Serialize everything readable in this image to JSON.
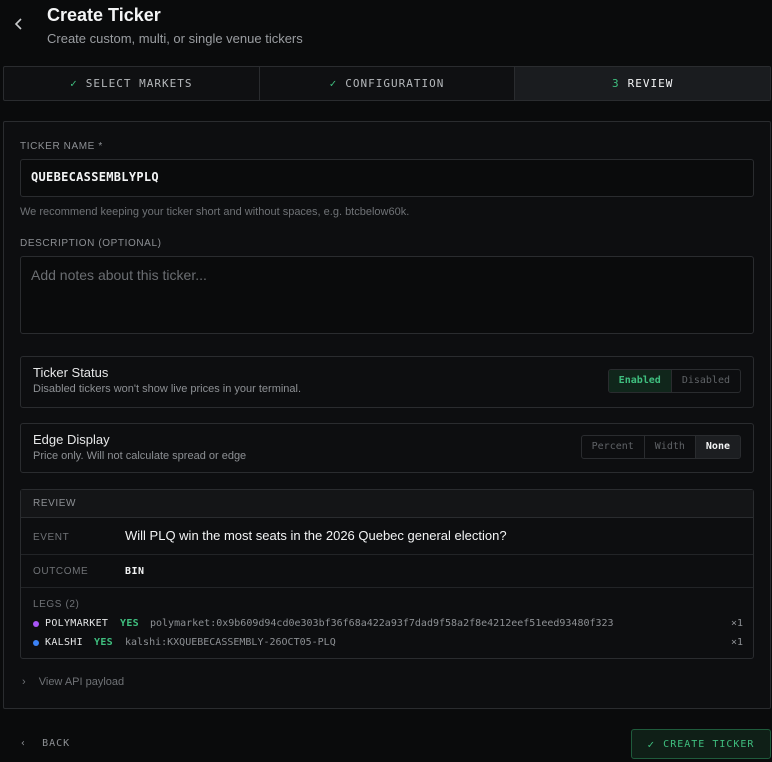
{
  "header": {
    "title": "Create Ticker",
    "subtitle": "Create custom, multi, or single venue tickers"
  },
  "steps": [
    {
      "label": "SELECT MARKETS",
      "state": "done"
    },
    {
      "label": "CONFIGURATION",
      "state": "done"
    },
    {
      "number": "3",
      "label": "REVIEW",
      "state": "active"
    }
  ],
  "form": {
    "ticker_name_label": "TICKER NAME *",
    "ticker_name_value": "QUEBECASSEMBLYPLQ",
    "ticker_name_hint": "We recommend keeping your ticker short and without spaces, e.g. btcbelow60k.",
    "description_label": "DESCRIPTION (OPTIONAL)",
    "description_placeholder": "Add notes about this ticker..."
  },
  "status": {
    "title": "Ticker Status",
    "subtitle": "Disabled tickers won't show live prices in your terminal.",
    "options": [
      "Enabled",
      "Disabled"
    ],
    "selected": "Enabled"
  },
  "edge": {
    "title": "Edge Display",
    "subtitle": "Price only. Will not calculate spread or edge",
    "options": [
      "Percent",
      "Width",
      "None"
    ],
    "selected": "None"
  },
  "review": {
    "header": "REVIEW",
    "event_label": "EVENT",
    "event_value": "Will PLQ win the most seats in the 2026 Quebec general election?",
    "outcome_label": "OUTCOME",
    "outcome_value": "BIN",
    "legs_label": "LEGS (2)",
    "legs": [
      {
        "venue": "POLYMARKET",
        "side": "YES",
        "market": "polymarket:0x9b609d94cd0e303bf36f68a422a93f7dad9f58a2f8e4212eef51eed93480f323",
        "qty": "×1",
        "color": "#a855f7"
      },
      {
        "venue": "KALSHI",
        "side": "YES",
        "market": "kalshi:KXQUEBECASSEMBLY-26OCT05-PLQ",
        "qty": "×1",
        "color": "#3b82f6"
      }
    ]
  },
  "api_payload_label": "View API payload",
  "footer": {
    "back_label": "BACK",
    "create_label": "CREATE TICKER"
  },
  "colors": {
    "accent_green": "#3fbf7f",
    "background": "#0a0b0c"
  }
}
